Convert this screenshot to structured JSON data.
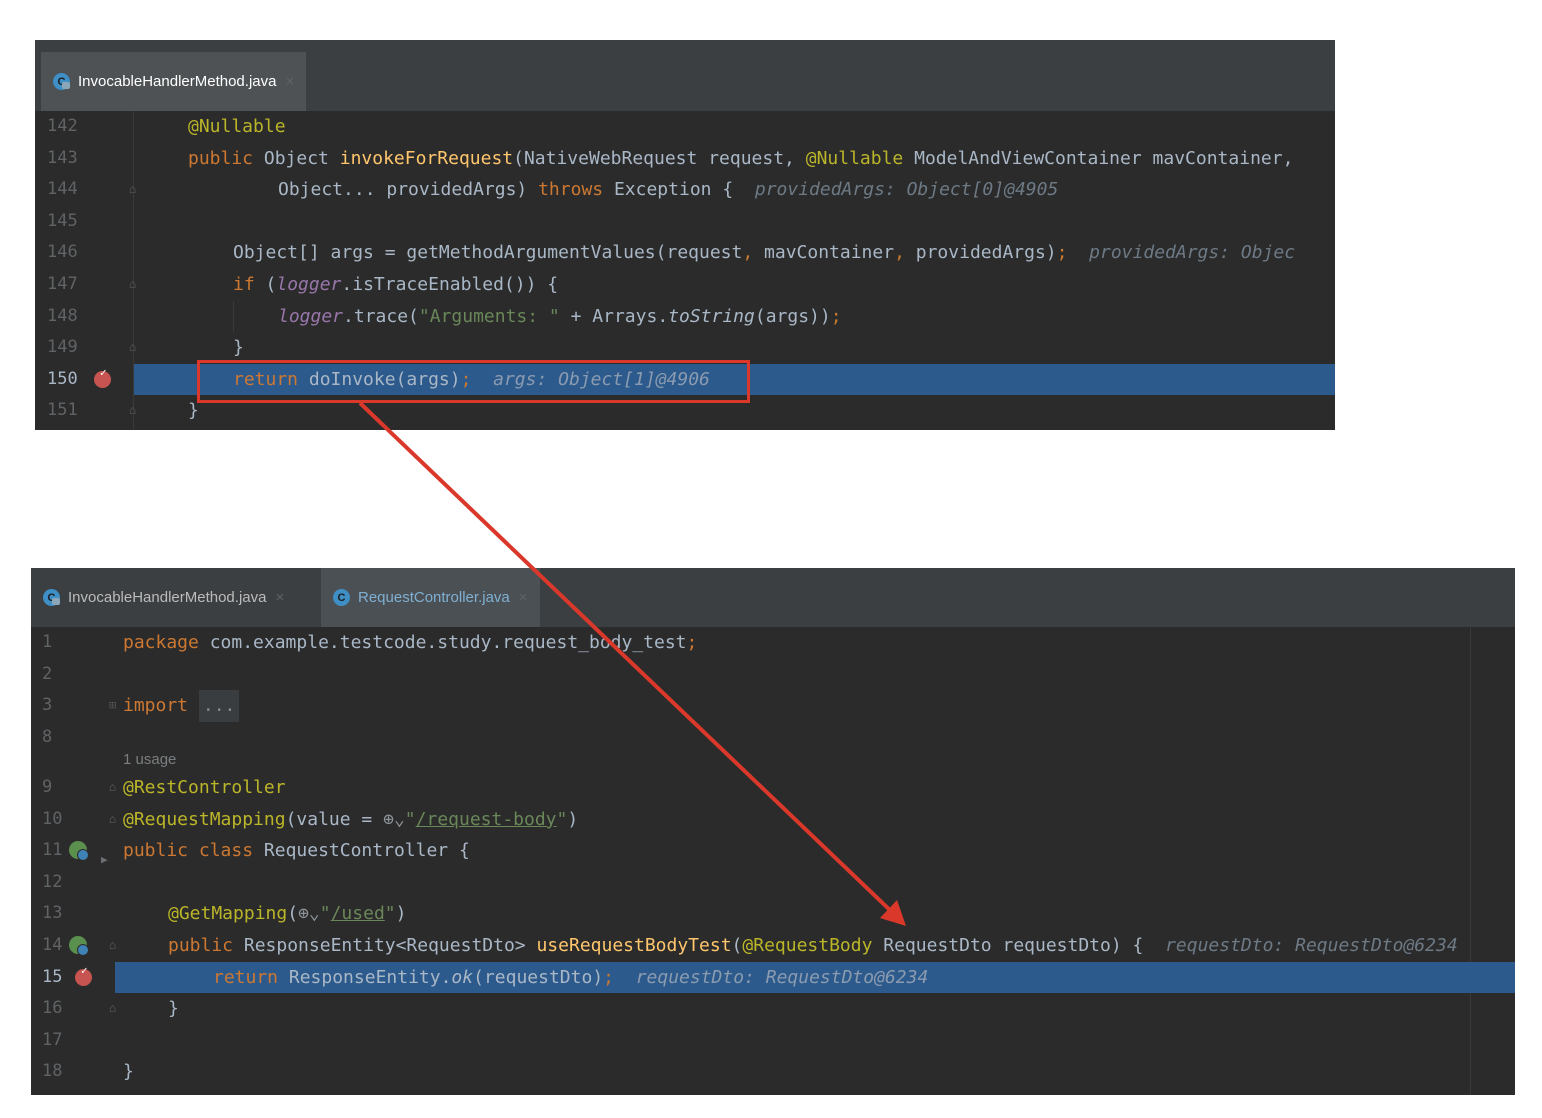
{
  "top_editor": {
    "tab": {
      "label": "InvocableHandlerMethod.java",
      "icon": "class-icon"
    },
    "lines": [
      {
        "num": "142"
      },
      {
        "num": "143"
      },
      {
        "num": "144"
      },
      {
        "num": "145"
      },
      {
        "num": "146"
      },
      {
        "num": "147"
      },
      {
        "num": "148"
      },
      {
        "num": "149"
      },
      {
        "num": "150"
      },
      {
        "num": "151"
      }
    ],
    "code": {
      "l142_ann": "@Nullable",
      "l143_public": "public",
      "l143_obj": " Object ",
      "l143_fn": "invokeForRequest",
      "l143_rest1": "(NativeWebRequest request, ",
      "l143_ann": "@Nullable",
      "l143_rest2": " ModelAndViewContainer mavContainer,",
      "l144_a": "Object... providedArgs) ",
      "l144_throws": "throws",
      "l144_b": " Exception {",
      "l144_hint": "providedArgs: Object[0]@4905",
      "l146_a": "Object[] args = getMethodArgumentValues(request",
      "l146_comma1": ",",
      "l146_b": " mavContainer",
      "l146_comma2": ",",
      "l146_c": " providedArgs)",
      "l146_semi": ";",
      "l146_hint": "providedArgs: Objec",
      "l147_if": "if",
      "l147_a": " (",
      "l147_logger": "logger",
      "l147_b": ".isTraceEnabled()) {",
      "l148_logger": "logger",
      "l148_a": ".trace(",
      "l148_str": "\"Arguments: \"",
      "l148_b": " + Arrays.",
      "l148_tostr": "toString",
      "l148_c": "(args))",
      "l148_semi": ";",
      "l149": "}",
      "l150_return": "return",
      "l150_a": " doInvoke(args)",
      "l150_semi": ";",
      "l150_hint": "args: Object[1]@4906",
      "l151": "}"
    }
  },
  "bottom_editor": {
    "tabs": [
      {
        "label": "InvocableHandlerMethod.java",
        "icon": "class-icon"
      },
      {
        "label": "RequestController.java",
        "icon": "class-icon"
      }
    ],
    "lines": [
      {
        "num": "1"
      },
      {
        "num": "2"
      },
      {
        "num": "3"
      },
      {
        "num": "8"
      },
      {
        "num": "9"
      },
      {
        "num": "10"
      },
      {
        "num": "11"
      },
      {
        "num": "12"
      },
      {
        "num": "13"
      },
      {
        "num": "14"
      },
      {
        "num": "15"
      },
      {
        "num": "16"
      },
      {
        "num": "17"
      },
      {
        "num": "18"
      }
    ],
    "usage_hint": "1 usage",
    "code": {
      "l1_package": "package",
      "l1_a": " com.example.testcode.study.request_body_test",
      "l1_semi": ";",
      "l3_import": "import",
      "l3_fold": "...",
      "l9_ann": "@RestController",
      "l10_ann": "@RequestMapping",
      "l10_a": "(value = ",
      "l10_q1": "\"",
      "l10_url": "/request-body",
      "l10_q2": "\"",
      "l10_b": ")",
      "l11_public": "public",
      "l11_class": " class",
      "l11_a": " RequestController {",
      "l13_ann": "@GetMapping",
      "l13_a": "(",
      "l13_q1": "\"",
      "l13_url": "/used",
      "l13_q2": "\"",
      "l13_b": ")",
      "l14_public": "public",
      "l14_a": " ResponseEntity<RequestDto> ",
      "l14_fn": "useRequestBodyTest",
      "l14_b": "(",
      "l14_ann": "@RequestBody",
      "l14_c": " RequestDto requestDto) {",
      "l14_hint": "requestDto: RequestDto@6234",
      "l15_return": "return",
      "l15_a": " ResponseEntity.",
      "l15_ok": "ok",
      "l15_b": "(requestDto)",
      "l15_semi": ";",
      "l15_hint": "requestDto: RequestDto@6234",
      "l16": "}",
      "l18": "}"
    }
  },
  "colors": {
    "annotation_box": "#d9382a",
    "arrow": "#d9382a",
    "execution_line": "#2d5a8c",
    "editor_bg": "#2b2b2b"
  }
}
